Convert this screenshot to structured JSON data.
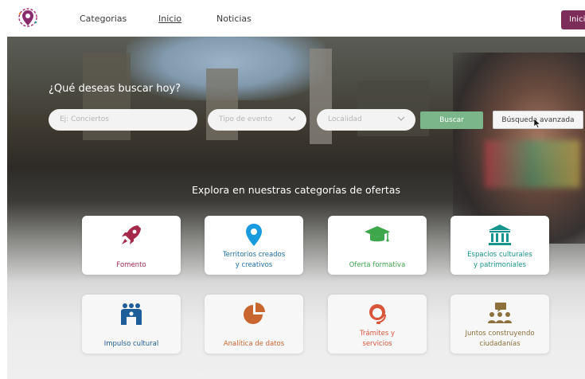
{
  "header": {
    "nav": [
      "Categorias",
      "Inicio",
      "Noticias"
    ],
    "login_label": "Inici"
  },
  "hero": {
    "title": "¿Qué deseas buscar hoy?",
    "search_placeholder": "Ej: Conciertos",
    "event_type_placeholder": "Tipo de evento",
    "location_placeholder": "Localidad",
    "search_button": "Buscar",
    "advanced_button": "Búsqueda avanzada",
    "explore_title": "Explora en nuestras categorías de ofertas"
  },
  "categories": [
    {
      "line1": "Fomento",
      "line2": "",
      "color": "#a52a4a",
      "icon": "rocket-icon"
    },
    {
      "line1": "Territorios creados",
      "line2": "y creativos",
      "color": "#1d6fa6",
      "icon": "map-pin-icon"
    },
    {
      "line1": "Oferta formativa",
      "line2": "",
      "color": "#3ea64b",
      "icon": "graduation-cap-icon"
    },
    {
      "line1": "Espacios culturales",
      "line2": "y patrimoniales",
      "color": "#17948c",
      "icon": "museum-icon"
    },
    {
      "line1": "Impulso cultural",
      "line2": "",
      "color": "#1d5d9a",
      "icon": "people-group-icon"
    },
    {
      "line1": "Analítica de datos",
      "line2": "",
      "color": "#c9652f",
      "icon": "pie-chart-icon"
    },
    {
      "line1": "Trámites y",
      "line2": "servicios",
      "color": "#d8553a",
      "icon": "support-agent-icon"
    },
    {
      "line1": "Juntos construyendo",
      "line2": "ciudadanías",
      "color": "#8c6f3a",
      "icon": "community-icon"
    }
  ]
}
